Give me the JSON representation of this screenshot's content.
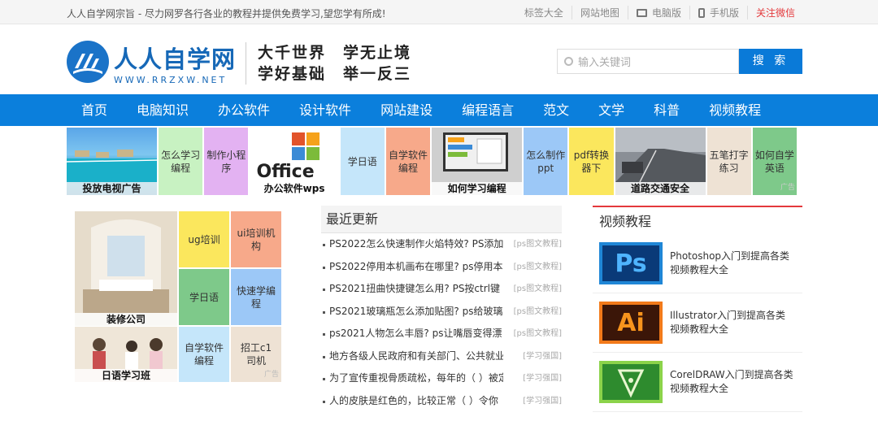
{
  "topbar": {
    "slogan": "人人自学网宗旨 - 尽力网罗各行各业的教程并提供免费学习,望您学有所成!",
    "links": [
      "标签大全",
      "网站地图",
      "电脑版",
      "手机版"
    ],
    "follow": "关注微信"
  },
  "header": {
    "brand": "人人自学网",
    "domain": "WWW.RRZXW.NET",
    "motto_line1": "大千世界　学无止境",
    "motto_line2": "学好基础　举一反三"
  },
  "search": {
    "placeholder": "输入关键词",
    "button": "搜 索"
  },
  "nav": [
    "首页",
    "电脑知识",
    "办公软件",
    "设计软件",
    "网站建设",
    "编程语言",
    "范文",
    "文学",
    "科普",
    "视频教程"
  ],
  "ads": {
    "tv": "投放电视广告",
    "learn_prog": "怎么学习编程",
    "miniapp": "制作小程序",
    "office": "办公软件wps",
    "office_logo": "Office",
    "japanese": "学日语",
    "self_prog": "自学软件编程",
    "how_prog": "如何学习编程",
    "ppt": "怎么制作ppt",
    "pdf": "pdf转换器下",
    "traffic": "道路交通安全",
    "wubi": "五笔打字练习",
    "english": "如何自学英语",
    "ad_tag": "广告"
  },
  "left_ads": {
    "decor": "装修公司",
    "ug": "ug培训",
    "ui": "ui培训机构",
    "jp": "学日语",
    "fast_prog": "快速学编程",
    "self_prog": "自学软件编程",
    "c1": "招工c1司机",
    "jp_class": "日语学习班",
    "ad_tag": "广告"
  },
  "recent": {
    "title": "最近更新",
    "items": [
      {
        "text": "PS2022怎么快速制作火焰特效? PS添加",
        "cat": "[ps图文教程]"
      },
      {
        "text": "PS2022停用本机画布在哪里? ps停用本",
        "cat": "[ps图文教程]"
      },
      {
        "text": "PS2021扭曲快捷键怎么用? PS按ctrl键",
        "cat": "[ps图文教程]"
      },
      {
        "text": "PS2021玻璃瓶怎么添加贴图? ps给玻璃",
        "cat": "[ps图文教程]"
      },
      {
        "text": "ps2021人物怎么丰唇? ps让嘴唇变得漂",
        "cat": "[ps图文教程]"
      },
      {
        "text": "地方各级人民政府和有关部门、公共就业",
        "cat": "[学习强国]"
      },
      {
        "text": "为了宣传重视骨质疏松，每年的（ ）被定",
        "cat": "[学习强国]"
      },
      {
        "text": "人的皮肤是红色的，比较正常（ ）令你",
        "cat": "[学习强国]"
      }
    ]
  },
  "videos": {
    "title": "视频教程",
    "items": [
      {
        "icon": "Ps",
        "title": "Photoshop入门到提高各类视频教程大全"
      },
      {
        "icon": "Ai",
        "title": "Illustrator入门到提高各类视频教程大全"
      },
      {
        "icon": "CDR",
        "title": "CorelDRAW入门到提高各类视频教程大全"
      }
    ]
  },
  "colors": {
    "nav": "#0b7fdc",
    "accent_red": "#e4393c",
    "brand_blue": "#1668b7"
  }
}
